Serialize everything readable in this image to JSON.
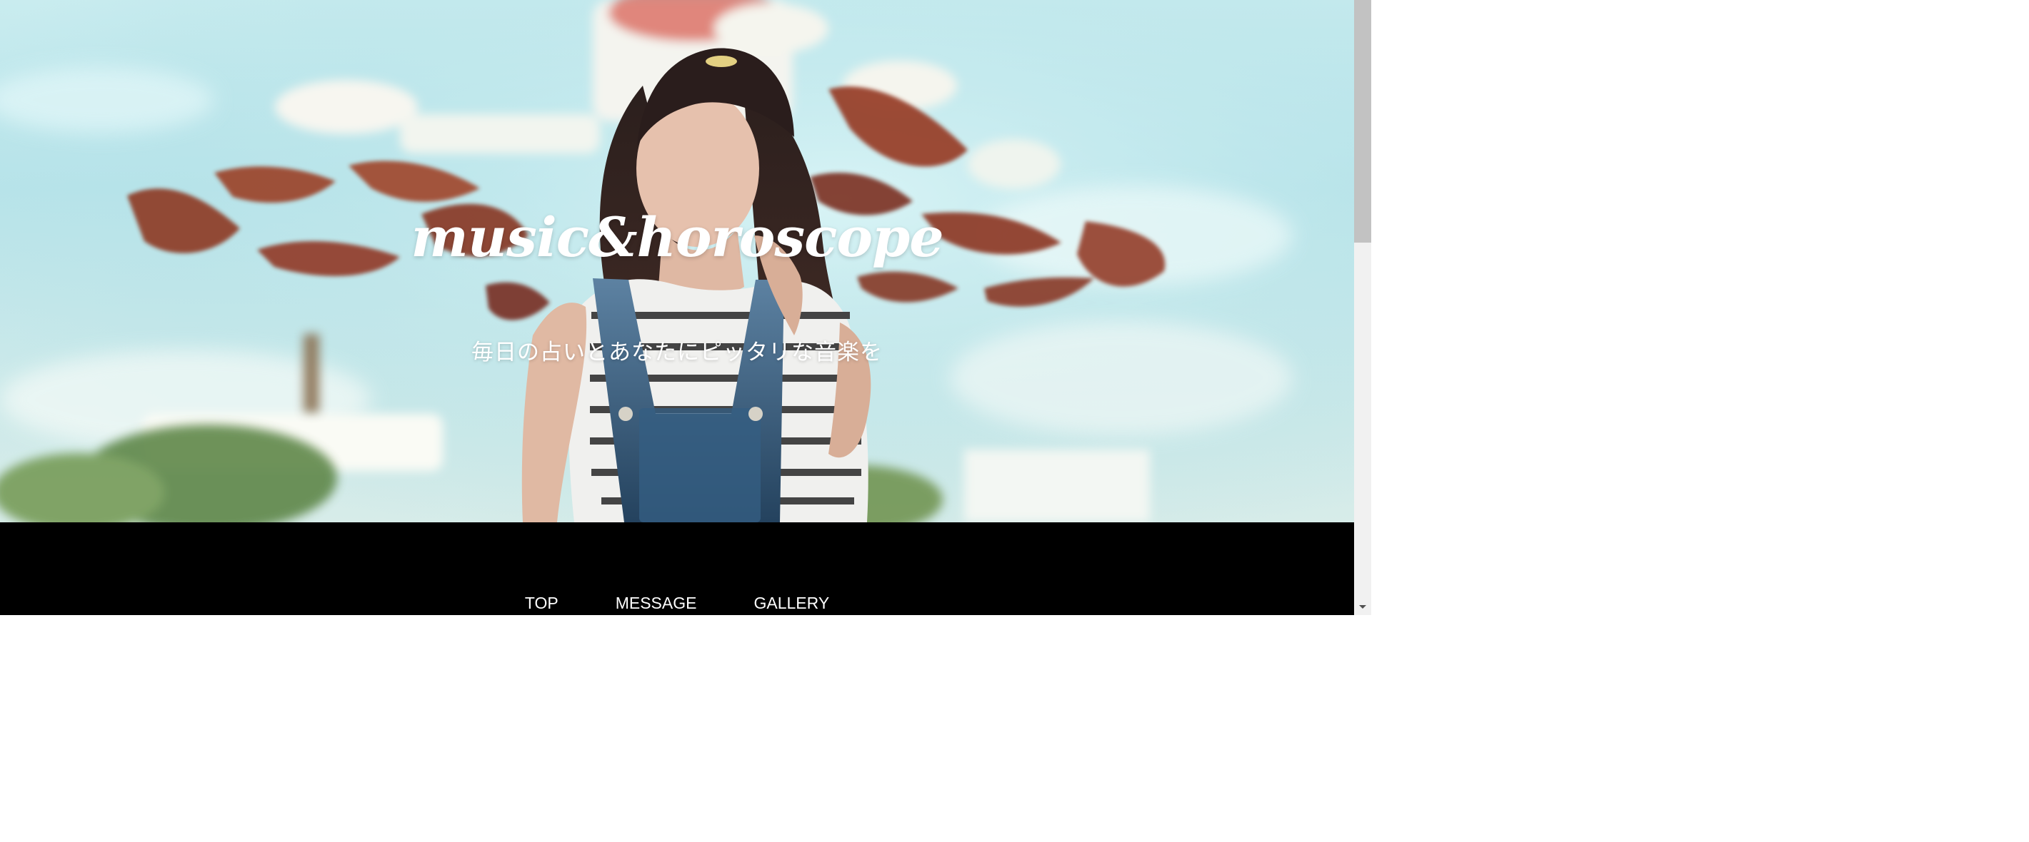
{
  "site": {
    "title": "music&horoscope",
    "tagline": "毎日の占いとあなたにピッタリな音楽を"
  },
  "navigation": {
    "items": [
      {
        "label": "TOP"
      },
      {
        "label": "MESSAGE"
      },
      {
        "label": "GALLERY"
      }
    ]
  },
  "hero": {
    "image": "woman-in-denim-overalls-in-front-of-swing-ride"
  },
  "colors": {
    "nav_background": "#000000",
    "text": "#ffffff",
    "sky": "#b9e4ea"
  }
}
